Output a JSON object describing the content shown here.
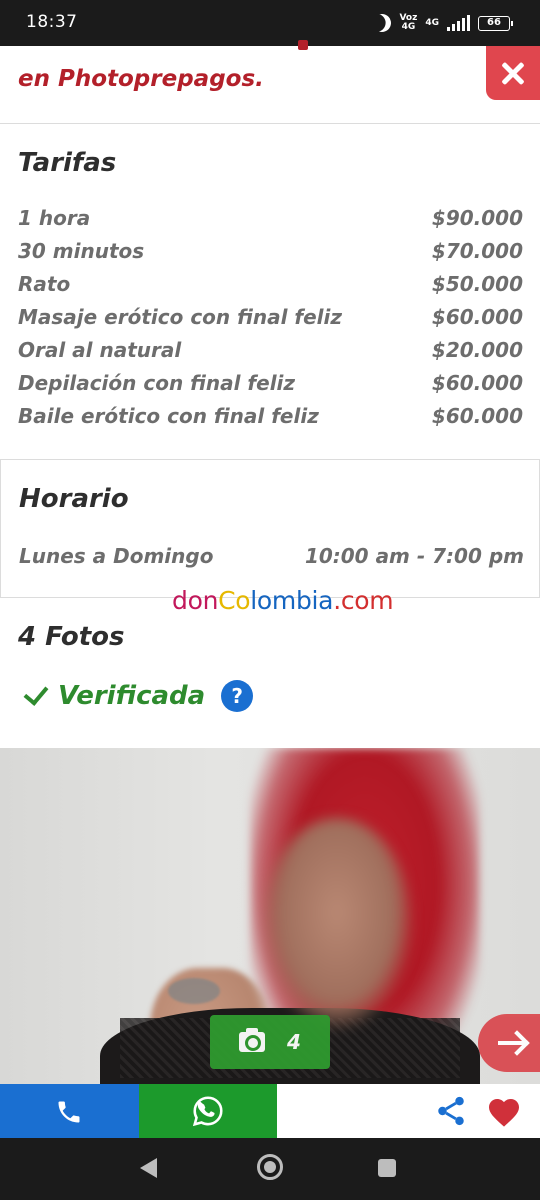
{
  "status_bar": {
    "time": "18:37",
    "network_top": "Voz",
    "network_bottom": "4G",
    "network2": "4G",
    "battery": "66"
  },
  "header": {
    "subtitle": "en Photoprepagos."
  },
  "tarifas": {
    "title": "Tarifas",
    "items": [
      {
        "label": "1 hora",
        "price": "$90.000"
      },
      {
        "label": "30 minutos",
        "price": "$70.000"
      },
      {
        "label": "Rato",
        "price": "$50.000"
      },
      {
        "label": "Masaje erótico con final feliz",
        "price": "$60.000"
      },
      {
        "label": "Oral al natural",
        "price": "$20.000"
      },
      {
        "label": "Depilación con final feliz",
        "price": "$60.000"
      },
      {
        "label": "Baile erótico con final feliz",
        "price": "$60.000"
      }
    ]
  },
  "horario": {
    "title": "Horario",
    "days": "Lunes a Domingo",
    "hours": "10:00 am - 7:00 pm"
  },
  "watermark": {
    "part1": "don",
    "part2": "Co",
    "part3": "lombia",
    "part4": ".com"
  },
  "photos": {
    "title": "4 Fotos",
    "verified_label": "Verificada",
    "help_symbol": "?",
    "count": "4"
  },
  "colors": {
    "accent_red": "#b3202a",
    "call_blue": "#1a6fd1",
    "whatsapp_green": "#1c9a2c",
    "verified_green": "#2e8b2e"
  },
  "icons": [
    "close-icon",
    "checkmark-icon",
    "help-icon",
    "camera-icon",
    "arrow-right-icon",
    "phone-icon",
    "whatsapp-icon",
    "share-icon",
    "heart-icon",
    "back-icon",
    "home-icon",
    "recents-icon"
  ]
}
